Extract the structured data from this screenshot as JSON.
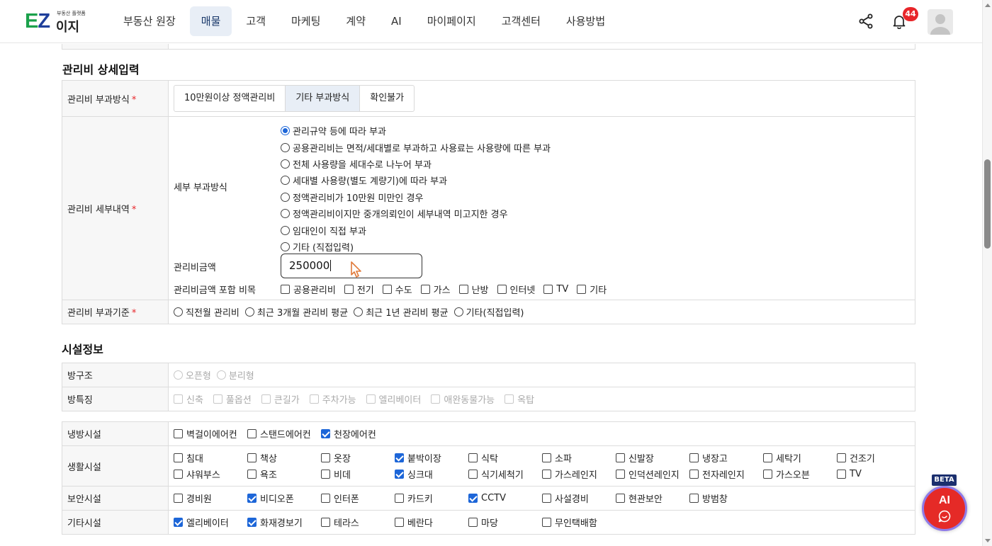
{
  "logo": {
    "text_e": "E",
    "text_z": "Z",
    "text_easy": "이지",
    "subtitle": "부동산 플랫폼"
  },
  "nav": {
    "items": [
      "부동산 원장",
      "매물",
      "고객",
      "마케팅",
      "계약",
      "AI",
      "마이페이지",
      "고객센터",
      "사용방법"
    ],
    "active_index": 1
  },
  "header": {
    "notification_count": "44"
  },
  "mgmt": {
    "title": "관리비 상세입력",
    "method": {
      "label": "관리비 부과방식",
      "options": [
        "10만원이상 정액관리비",
        "기타 부과방식",
        "확인불가"
      ],
      "selected_index": 1
    },
    "detail": {
      "label": "관리비 세부내역",
      "sub_label": "세부 부과방식",
      "options": [
        "관리규약 등에 따라 부과",
        "공용관리비는 면적/세대별로 부과하고 사용료는 사용량에 따른 부과",
        "전체 사용량을 세대수로 나누어 부과",
        "세대별 사용량(별도 계량기)에 따라 부과",
        "정액관리비가 10만원 미만인 경우",
        "정액관리비이지만 중개의뢰인이 세부내역 미고지한 경우",
        "임대인이 직접 부과",
        "기타 (직접입력)"
      ],
      "selected_index": 0,
      "amount_label": "관리비금액",
      "amount_value": "250000",
      "items_label": "관리비금액 포함 비목",
      "items": [
        "공용관리비",
        "전기",
        "수도",
        "가스",
        "난방",
        "인터넷",
        "TV",
        "기타"
      ]
    },
    "basis": {
      "label": "관리비 부과기준",
      "options": [
        "직전월 관리비",
        "최근 3개월 관리비 평균",
        "최근 1년 관리비 평균",
        "기타(직접입력)"
      ]
    }
  },
  "facility": {
    "title": "시설정보",
    "room_structure": {
      "label": "방구조",
      "options": [
        "오픈형",
        "분리형"
      ]
    },
    "room_features": {
      "label": "방특징",
      "options": [
        "신축",
        "풀옵션",
        "큰길가",
        "주차가능",
        "엘리베이터",
        "애완동물가능",
        "옥탑"
      ]
    },
    "cooling": {
      "label": "냉방시설",
      "options": [
        {
          "t": "벽걸이에어컨",
          "on": false
        },
        {
          "t": "스탠드에어컨",
          "on": false
        },
        {
          "t": "천장에어컨",
          "on": true
        }
      ]
    },
    "living": {
      "label": "생활시설",
      "options": [
        {
          "t": "침대",
          "on": false
        },
        {
          "t": "책상",
          "on": false
        },
        {
          "t": "옷장",
          "on": false
        },
        {
          "t": "붙박이장",
          "on": true
        },
        {
          "t": "식탁",
          "on": false
        },
        {
          "t": "소파",
          "on": false
        },
        {
          "t": "신발장",
          "on": false
        },
        {
          "t": "냉장고",
          "on": false
        },
        {
          "t": "세탁기",
          "on": false
        },
        {
          "t": "건조기",
          "on": false
        },
        {
          "t": "샤워부스",
          "on": false
        },
        {
          "t": "욕조",
          "on": false
        },
        {
          "t": "비데",
          "on": false
        },
        {
          "t": "싱크대",
          "on": true
        },
        {
          "t": "식기세척기",
          "on": false
        },
        {
          "t": "가스레인지",
          "on": false
        },
        {
          "t": "인덕션레인지",
          "on": false
        },
        {
          "t": "전자레인지",
          "on": false
        },
        {
          "t": "가스오븐",
          "on": false
        },
        {
          "t": "TV",
          "on": false
        }
      ]
    },
    "security": {
      "label": "보안시설",
      "options": [
        {
          "t": "경비원",
          "on": false
        },
        {
          "t": "비디오폰",
          "on": true
        },
        {
          "t": "인터폰",
          "on": false
        },
        {
          "t": "카드키",
          "on": false
        },
        {
          "t": "CCTV",
          "on": true
        },
        {
          "t": "사설경비",
          "on": false
        },
        {
          "t": "현관보안",
          "on": false
        },
        {
          "t": "방범창",
          "on": false
        }
      ]
    },
    "other": {
      "label": "기타시설",
      "options": [
        {
          "t": "엘리베이터",
          "on": true
        },
        {
          "t": "화재경보기",
          "on": true
        },
        {
          "t": "테라스",
          "on": false
        },
        {
          "t": "베란다",
          "on": false
        },
        {
          "t": "마당",
          "on": false
        },
        {
          "t": "무인택배함",
          "on": false
        }
      ]
    }
  },
  "ai_button": {
    "beta": "BETA",
    "label": "AI"
  },
  "colors": {
    "accent": "#1d66d8",
    "nav_active_bg": "#e8eef6",
    "badge": "#e8262a",
    "ai_button": "#e52a27"
  }
}
